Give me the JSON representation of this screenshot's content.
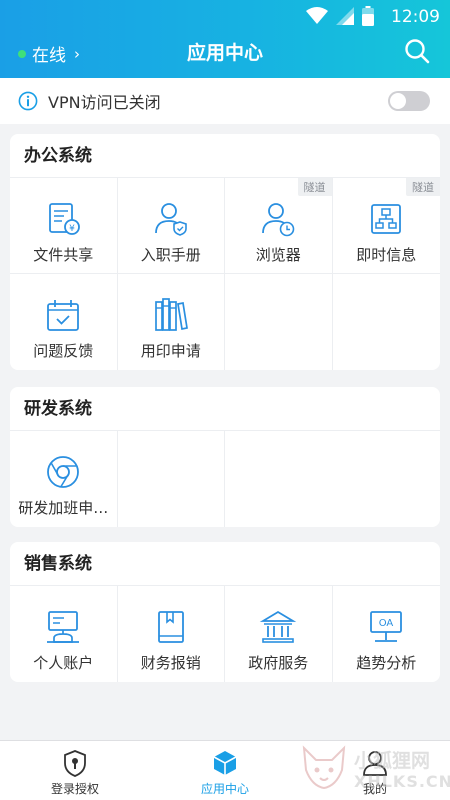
{
  "status_bar": {
    "time": "12:09",
    "icons": [
      "wifi-icon",
      "signal-icon",
      "battery-icon"
    ]
  },
  "header": {
    "online_status": "在线",
    "title": "应用中心",
    "search_icon": "search-icon"
  },
  "vpn": {
    "label": "VPN访问已关闭",
    "enabled": false
  },
  "sections": [
    {
      "title": "办公系统",
      "apps": [
        {
          "label": "文件共享",
          "icon": "file-share-icon",
          "badge": ""
        },
        {
          "label": "入职手册",
          "icon": "user-shield-icon",
          "badge": ""
        },
        {
          "label": "浏览器",
          "icon": "user-clock-icon",
          "badge": "隧道"
        },
        {
          "label": "即时信息",
          "icon": "org-chart-icon",
          "badge": "隧道"
        },
        {
          "label": "问题反馈",
          "icon": "calendar-check-icon",
          "badge": ""
        },
        {
          "label": "用印申请",
          "icon": "books-icon",
          "badge": ""
        }
      ]
    },
    {
      "title": "研发系统",
      "apps": [
        {
          "label": "研发加班申…",
          "icon": "chrome-icon",
          "badge": ""
        }
      ]
    },
    {
      "title": "销售系统",
      "apps": [
        {
          "label": "个人账户",
          "icon": "desk-user-icon",
          "badge": ""
        },
        {
          "label": "财务报销",
          "icon": "ledger-book-icon",
          "badge": ""
        },
        {
          "label": "政府服务",
          "icon": "government-building-icon",
          "badge": ""
        },
        {
          "label": "趋势分析",
          "icon": "oa-board-icon",
          "badge": ""
        }
      ]
    }
  ],
  "tabbar": {
    "tabs": [
      {
        "label": "登录授权",
        "icon": "shield-keyhole-icon",
        "active": false
      },
      {
        "label": "应用中心",
        "icon": "cube-icon",
        "active": true
      },
      {
        "label": "我的",
        "icon": "user-icon",
        "active": false
      }
    ]
  },
  "watermark": {
    "line1": "小狐狸网",
    "line2": "XHLKS.CN"
  },
  "colors": {
    "accent": "#1a9fe6",
    "header_gradient_end": "#15c6d9",
    "online_dot": "#3fe07a"
  }
}
